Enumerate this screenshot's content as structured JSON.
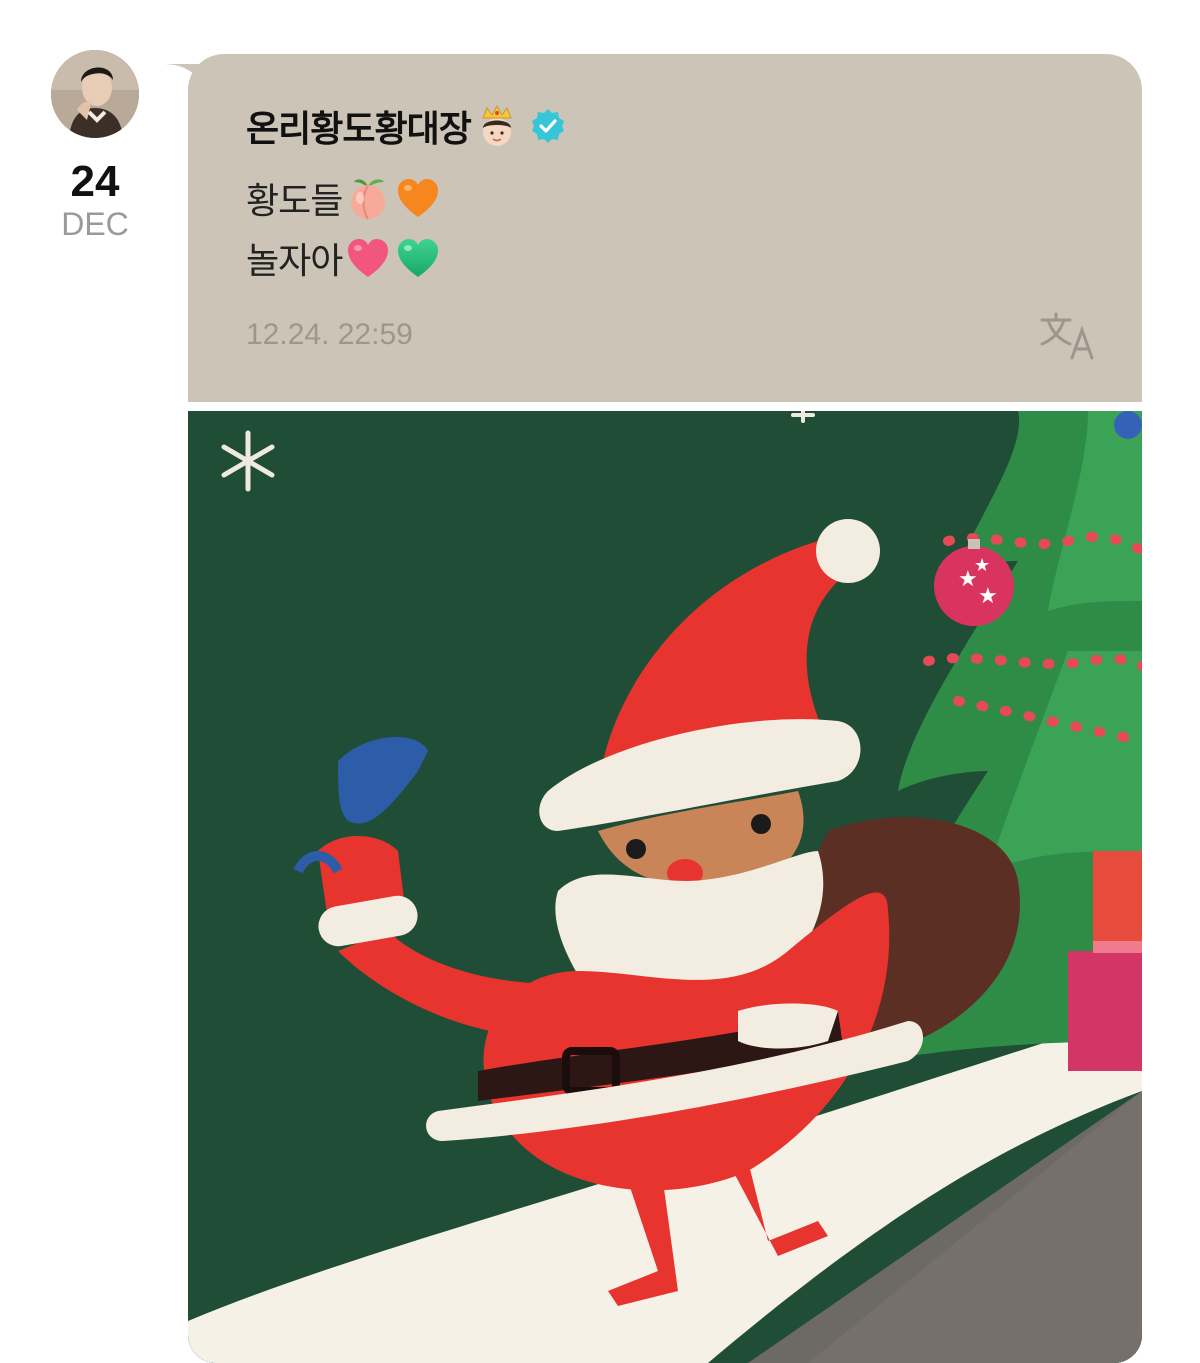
{
  "post": {
    "author": {
      "name": "온리황도황대장",
      "badge_emoji": "crown-boy-emoji",
      "verified": true
    },
    "date": {
      "day": "24",
      "month": "DEC"
    },
    "message": {
      "line1": "황도들",
      "line1_emojis": [
        "peach-emoji",
        "orange-heart-emoji"
      ],
      "line2": "놀자아",
      "line2_emojis": [
        "pink-heart-emoji",
        "green-heart-emoji"
      ]
    },
    "timestamp": "12.24. 22:59",
    "icons": {
      "translate": "translate-icon",
      "avatar": "avatar"
    },
    "colors": {
      "bubble_background": "#cdc4b8",
      "verified": "#36c6d8",
      "photo_background": "#1d4a33"
    }
  }
}
